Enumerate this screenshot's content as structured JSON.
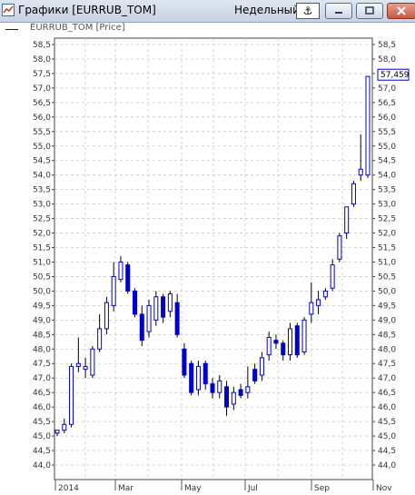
{
  "window": {
    "title": "Графики [EURRUB_TOM]",
    "period": "Недельный",
    "anchor_icon": "anchor-icon",
    "min_icon": "minimize-icon",
    "max_icon": "maximize-icon",
    "close_icon": "close-icon"
  },
  "legend": {
    "series_label": "EURRUB_TOM [Price]"
  },
  "price_label": "57,459",
  "chart_data": {
    "type": "candlestick",
    "series_name": "EURRUB_TOM [Price]",
    "ylim": [
      44.0,
      58.5
    ],
    "yticks": [
      "44,0",
      "44,5",
      "45,0",
      "45,5",
      "46,0",
      "46,5",
      "47,0",
      "47,5",
      "48,0",
      "48,5",
      "49,0",
      "49,5",
      "50,0",
      "50,5",
      "51,0",
      "51,5",
      "52,0",
      "52,5",
      "53,0",
      "53,5",
      "54,0",
      "54,5",
      "55,0",
      "55,5",
      "56,0",
      "56,5",
      "57,0",
      "57,5",
      "58,0",
      "58,5"
    ],
    "xticks": [
      "2014",
      "Mar",
      "May",
      "Jul",
      "Sep",
      "Nov"
    ],
    "grid": true,
    "last_price": 57.459,
    "candles": [
      {
        "o": 45.1,
        "h": 45.2,
        "l": 45.0,
        "c": 45.2
      },
      {
        "o": 45.2,
        "h": 45.6,
        "l": 45.1,
        "c": 45.4
      },
      {
        "o": 45.4,
        "h": 47.5,
        "l": 45.3,
        "c": 47.4
      },
      {
        "o": 47.4,
        "h": 48.4,
        "l": 47.2,
        "c": 47.5
      },
      {
        "o": 47.3,
        "h": 47.7,
        "l": 47.0,
        "c": 47.4
      },
      {
        "o": 47.1,
        "h": 48.1,
        "l": 47.0,
        "c": 48.0
      },
      {
        "o": 48.0,
        "h": 49.2,
        "l": 47.9,
        "c": 48.7
      },
      {
        "o": 48.7,
        "h": 49.8,
        "l": 48.5,
        "c": 49.6
      },
      {
        "o": 49.5,
        "h": 51.0,
        "l": 49.3,
        "c": 50.5
      },
      {
        "o": 50.4,
        "h": 51.2,
        "l": 50.3,
        "c": 51.0
      },
      {
        "o": 50.9,
        "h": 51.0,
        "l": 49.9,
        "c": 50.0
      },
      {
        "o": 50.0,
        "h": 50.1,
        "l": 49.1,
        "c": 49.2
      },
      {
        "o": 49.2,
        "h": 49.5,
        "l": 48.1,
        "c": 48.3
      },
      {
        "o": 48.6,
        "h": 49.7,
        "l": 48.4,
        "c": 49.5
      },
      {
        "o": 49.0,
        "h": 50.0,
        "l": 48.8,
        "c": 49.8
      },
      {
        "o": 49.8,
        "h": 49.9,
        "l": 48.9,
        "c": 49.1
      },
      {
        "o": 49.3,
        "h": 50.0,
        "l": 49.1,
        "c": 49.9
      },
      {
        "o": 49.6,
        "h": 49.9,
        "l": 48.4,
        "c": 48.5
      },
      {
        "o": 48.0,
        "h": 48.2,
        "l": 47.0,
        "c": 47.1
      },
      {
        "o": 47.5,
        "h": 47.6,
        "l": 46.4,
        "c": 46.5
      },
      {
        "o": 46.6,
        "h": 47.6,
        "l": 46.4,
        "c": 47.4
      },
      {
        "o": 47.5,
        "h": 47.6,
        "l": 46.6,
        "c": 46.8
      },
      {
        "o": 46.8,
        "h": 47.0,
        "l": 46.3,
        "c": 46.5
      },
      {
        "o": 46.5,
        "h": 47.1,
        "l": 46.3,
        "c": 46.9
      },
      {
        "o": 46.7,
        "h": 46.9,
        "l": 45.7,
        "c": 46.0
      },
      {
        "o": 46.1,
        "h": 46.7,
        "l": 45.9,
        "c": 46.5
      },
      {
        "o": 46.6,
        "h": 46.8,
        "l": 46.3,
        "c": 46.4
      },
      {
        "o": 46.5,
        "h": 47.4,
        "l": 46.3,
        "c": 46.7
      },
      {
        "o": 47.3,
        "h": 47.5,
        "l": 46.8,
        "c": 46.9
      },
      {
        "o": 47.1,
        "h": 47.9,
        "l": 46.9,
        "c": 47.7
      },
      {
        "o": 47.8,
        "h": 48.6,
        "l": 47.6,
        "c": 48.4
      },
      {
        "o": 48.3,
        "h": 48.5,
        "l": 48.0,
        "c": 48.2
      },
      {
        "o": 48.2,
        "h": 48.3,
        "l": 47.6,
        "c": 47.8
      },
      {
        "o": 47.8,
        "h": 48.9,
        "l": 47.6,
        "c": 48.7
      },
      {
        "o": 48.8,
        "h": 48.9,
        "l": 47.7,
        "c": 47.8
      },
      {
        "o": 47.9,
        "h": 49.1,
        "l": 47.8,
        "c": 49.0
      },
      {
        "o": 49.2,
        "h": 50.3,
        "l": 48.9,
        "c": 49.6
      },
      {
        "o": 49.5,
        "h": 50.0,
        "l": 49.2,
        "c": 49.7
      },
      {
        "o": 49.8,
        "h": 50.1,
        "l": 49.7,
        "c": 50.0
      },
      {
        "o": 50.1,
        "h": 51.1,
        "l": 50.0,
        "c": 50.9
      },
      {
        "o": 51.1,
        "h": 52.0,
        "l": 51.0,
        "c": 51.9
      },
      {
        "o": 52.0,
        "h": 52.9,
        "l": 51.8,
        "c": 52.9
      },
      {
        "o": 53.0,
        "h": 53.8,
        "l": 52.9,
        "c": 53.7
      },
      {
        "o": 54.0,
        "h": 55.4,
        "l": 53.8,
        "c": 54.2
      },
      {
        "o": 54.0,
        "h": 57.4,
        "l": 53.9,
        "c": 57.4
      }
    ]
  }
}
